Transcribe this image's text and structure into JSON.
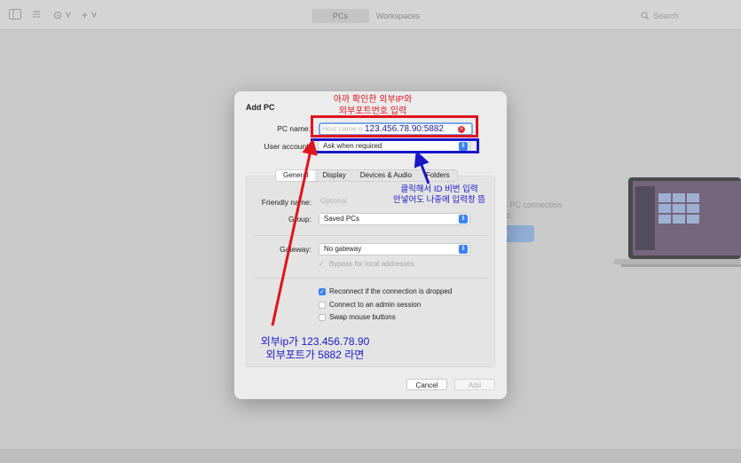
{
  "toolbar": {
    "tabs": [
      "PCs",
      "Workspaces"
    ],
    "search_placeholder": "Search",
    "add_label": "+ ˅",
    "more_label": "⊙ ˅"
  },
  "background": {
    "hint_line1": "st PC connection",
    "hint_line2": "ed.",
    "button_label": "c"
  },
  "dialog": {
    "title": "Add PC",
    "pc_name_label": "PC name:",
    "pc_name_placeholder": "Host name o",
    "pc_name_value": "123.456.78.90:5882",
    "user_account_label": "User account:",
    "user_account_value": "Ask when required",
    "tabs": [
      "General",
      "Display",
      "Devices & Audio",
      "Folders"
    ],
    "friendly_name_label": "Friendly name:",
    "friendly_name_placeholder": "Optional",
    "group_label": "Group:",
    "group_value": "Saved PCs",
    "gateway_label": "Gateway:",
    "gateway_value": "No gateway",
    "bypass_label": "Bypass for local addresses",
    "reconnect_label": "Reconnect if the connection is dropped",
    "admin_label": "Connect to an admin session",
    "swap_label": "Swap mouse buttons",
    "cancel_label": "Cancel",
    "add_label": "Add"
  },
  "annotations": {
    "red_line1": "아까 확인한 외부IP와",
    "red_line2": "외부포트번호 입력",
    "blue_line1": "클릭해서 ID 비번 입력",
    "blue_line2": "안넣어도 나중에 입력창 뜸",
    "bottom_line1": "외부ip가 123.456.78.90",
    "bottom_line2": "외부포트가 5882 라면",
    "red_color": "#e0141e",
    "blue_color": "#1a17c8"
  }
}
